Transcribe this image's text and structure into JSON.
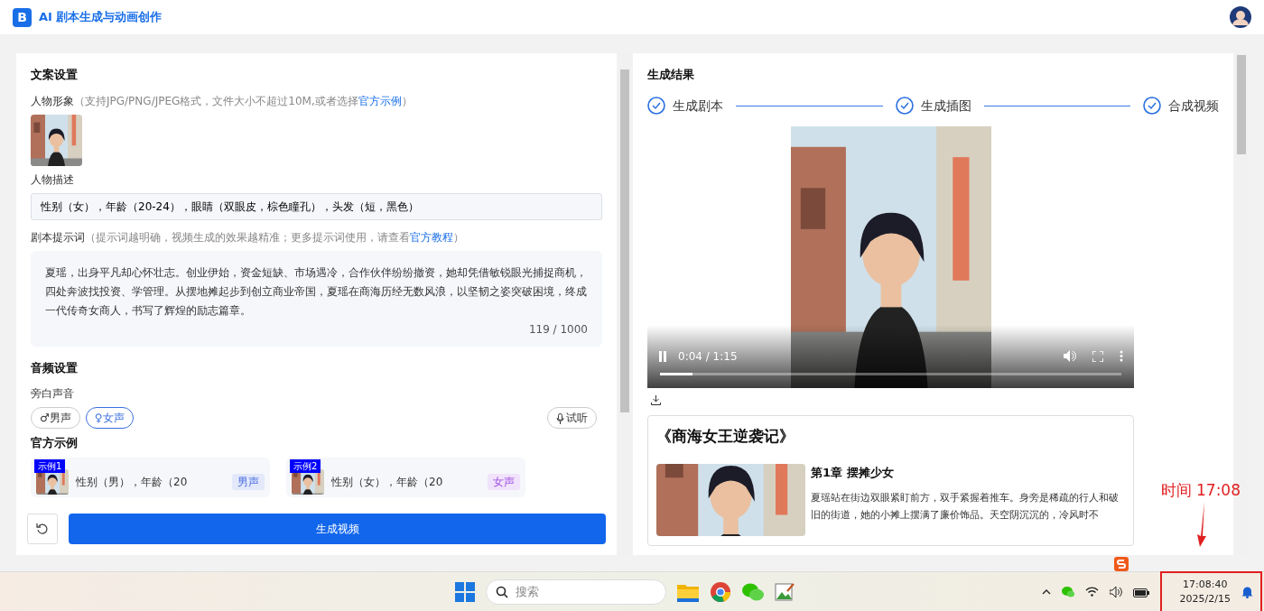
{
  "app": {
    "logo_text": "B",
    "title": "AI 剧本生成与动画创作"
  },
  "copy_settings": {
    "heading": "文案设置",
    "portrait": {
      "label": "人物形象",
      "hint_before": "（支持JPG/PNG/JPEG格式，文件大小不超过10M,或者选择",
      "hint_link": "官方示例",
      "hint_after": "）"
    },
    "description": {
      "label": "人物描述",
      "value": "性别（女），年龄（20-24），眼睛（双眼皮，棕色瞳孔），头发（短，黑色）"
    },
    "prompt": {
      "label": "剧本提示词",
      "hint_before": "（提示词越明确，视频生成的效果越精准；更多提示词使用，请查看",
      "hint_link": "官方教程",
      "hint_after": "）",
      "value": "夏瑶，出身平凡却心怀壮志。创业伊始，资金短缺、市场遇冷，合作伙伴纷纷撤资，她却凭借敏锐眼光捕捉商机，四处奔波找投资、学管理。从摆地摊起步到创立商业帝国，夏瑶在商海历经无数风浪，以坚韧之姿突破困境，终成一代传奇女商人，书写了辉煌的励志篇章。",
      "counter": "119 / 1000"
    }
  },
  "audio_settings": {
    "heading": "音频设置",
    "label": "旁白声音",
    "voices": [
      {
        "symbol": "♂",
        "label": "男声",
        "selected": false
      },
      {
        "symbol": "♀",
        "label": "女声",
        "selected": true
      }
    ],
    "preview_button": "试听"
  },
  "examples": {
    "heading": "官方示例",
    "items": [
      {
        "badge": "示例1",
        "text": "性别（男），年龄（20",
        "tag": "男声",
        "kind": "male"
      },
      {
        "badge": "示例2",
        "text": "性别（女），年龄（20",
        "tag": "女声",
        "kind": "female"
      }
    ]
  },
  "actions": {
    "generate_button": "生成视频"
  },
  "result": {
    "heading": "生成结果",
    "steps": [
      {
        "label": "生成剧本",
        "done": true
      },
      {
        "label": "生成插图",
        "done": true
      },
      {
        "label": "合成视频",
        "done": true
      }
    ],
    "video": {
      "time": "0:04 / 1:15",
      "level": 0.07,
      "playing": true
    },
    "story": {
      "title": "《商海女王逆袭记》",
      "chapters": [
        {
          "title": "第1章 摆摊少女",
          "text": "夏瑶站在街边双眼紧盯前方，双手紧握着推车。身旁是稀疏的行人和破旧的街道，她的小摊上摆满了廉价饰品。天空阴沉沉的，冷风时不"
        }
      ]
    }
  },
  "annotation": {
    "text": "时间 17:08"
  },
  "taskbar": {
    "search_placeholder": "搜索",
    "clock_time": "17:08:40",
    "clock_date": "2025/2/15"
  }
}
